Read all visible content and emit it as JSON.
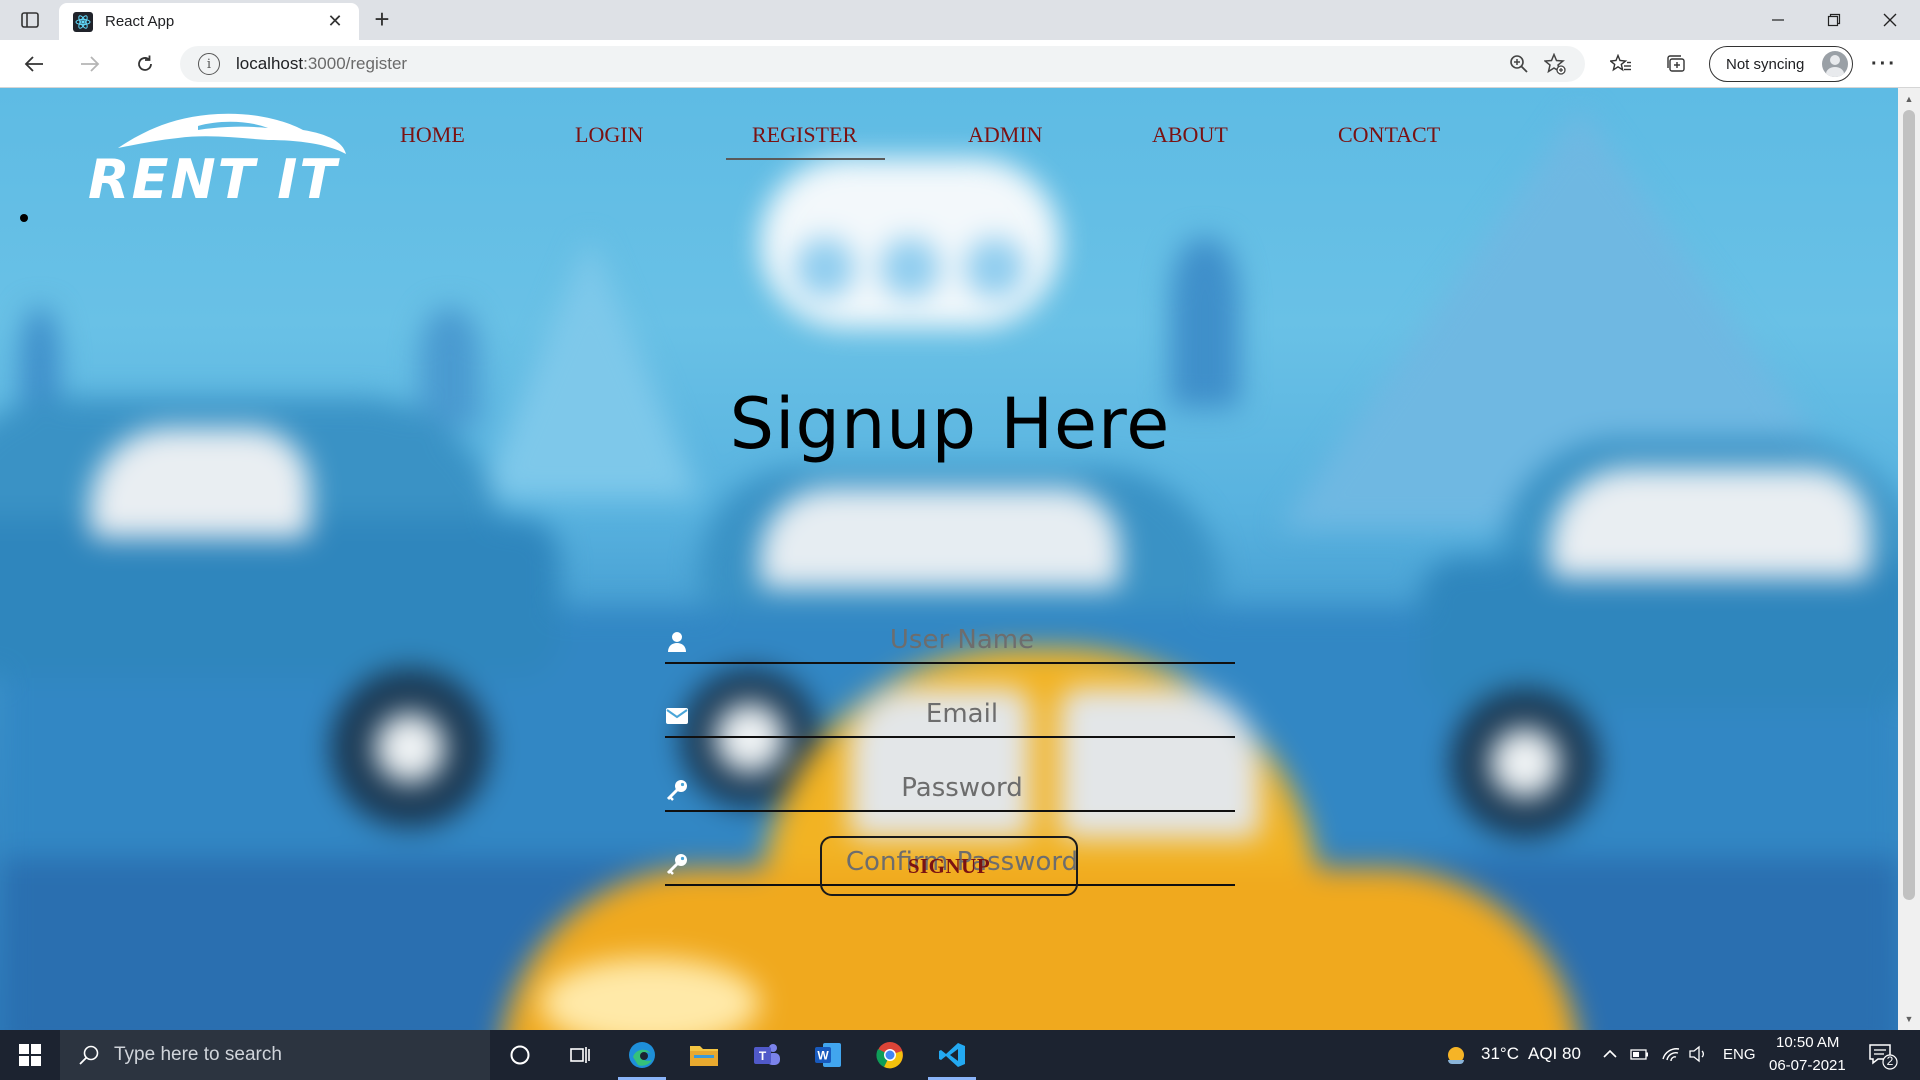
{
  "browser": {
    "tab_title": "React App",
    "url_host": "localhost",
    "url_path": ":3000/register",
    "sync_label": "Not syncing"
  },
  "page": {
    "logo_text": "RENT IT",
    "nav": [
      {
        "label": "HOME"
      },
      {
        "label": "LOGIN"
      },
      {
        "label": "REGISTER"
      },
      {
        "label": "ADMIN"
      },
      {
        "label": "ABOUT"
      },
      {
        "label": "CONTACT"
      }
    ],
    "active_nav": "REGISTER",
    "heading": "Signup Here",
    "fields": {
      "username_placeholder": "User Name",
      "email_placeholder": "Email",
      "password_placeholder": "Password",
      "confirm_placeholder": "Confirm Password"
    },
    "signup_label": "SIGNUP"
  },
  "taskbar": {
    "search_placeholder": "Type here to search",
    "weather": "31°C",
    "aqi": "AQI 80",
    "lang": "ENG",
    "time": "10:50 AM",
    "date": "06-07-2021",
    "notification_count": "2"
  },
  "colors": {
    "nav_text": "#7a1212",
    "sky": "#5ebbe4",
    "taskbar": "#1c2330"
  }
}
